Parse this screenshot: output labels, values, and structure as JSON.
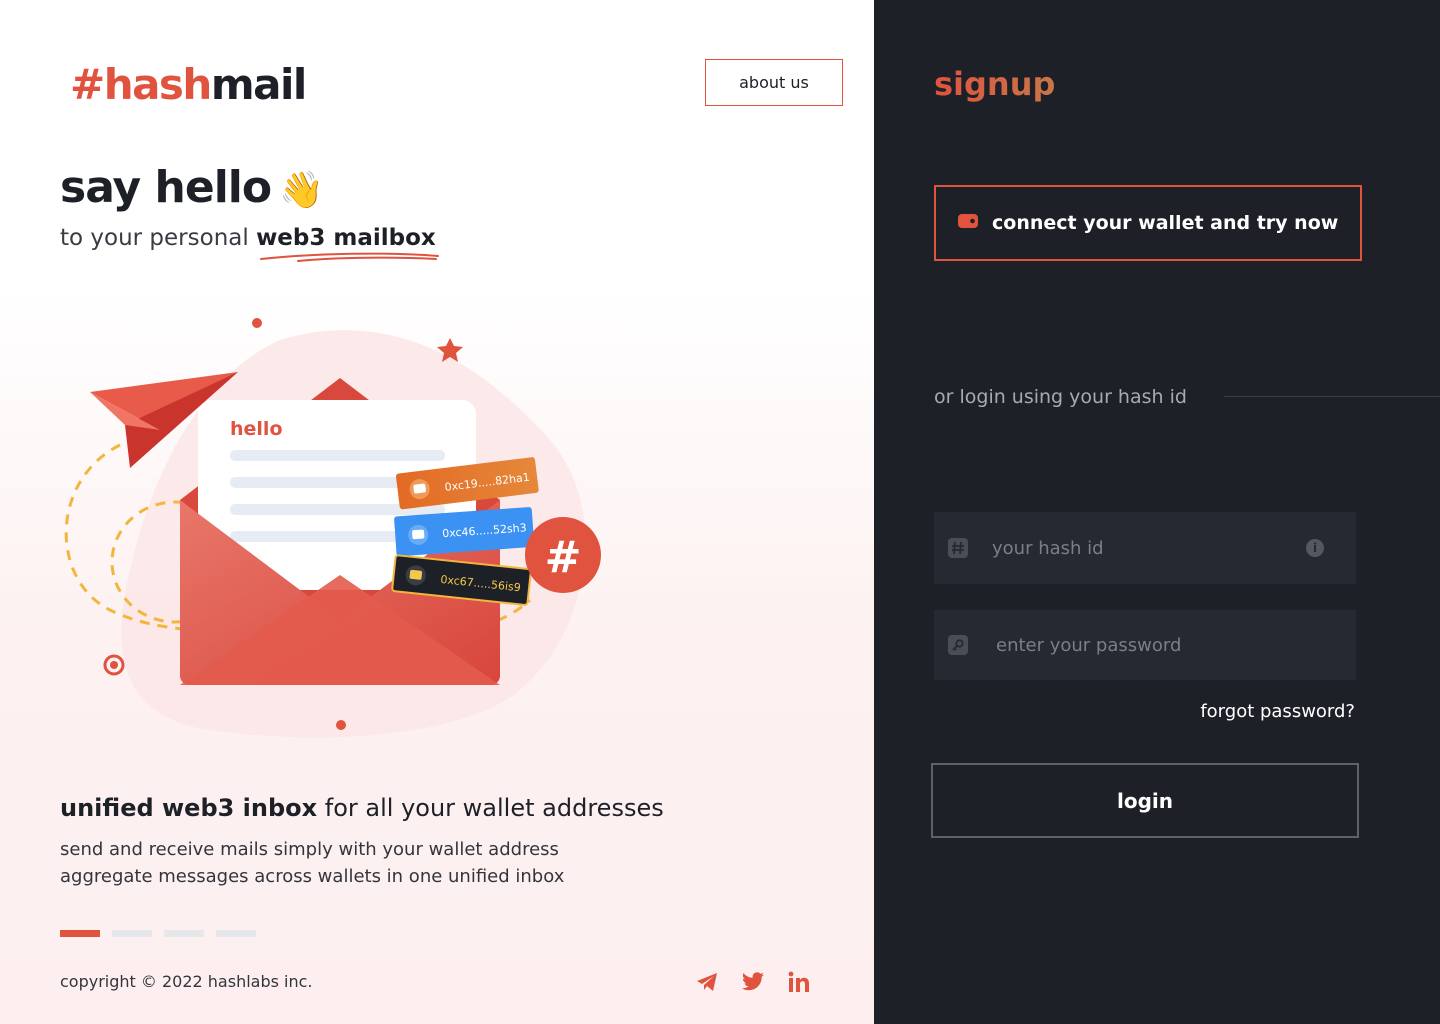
{
  "brand": {
    "logo_accent": "#hash",
    "logo_rest": "mail",
    "accent_color": "#e0533f",
    "dark_bg": "#1e2028"
  },
  "header": {
    "about_label": "about us"
  },
  "hero": {
    "title": "say hello",
    "wave_icon": "👋",
    "subtitle_prefix": "to your personal ",
    "subtitle_highlight": "web3 mailbox"
  },
  "illustration": {
    "mail_greeting": "hello",
    "wallets": [
      {
        "label": "0xc19.....82ha1",
        "color": "#e37a27"
      },
      {
        "label": "0xc46.....52sh3",
        "color": "#3b92f3"
      },
      {
        "label": "0xc67.....56is9",
        "color": "#1e2028"
      }
    ],
    "hash_badge": "#"
  },
  "feature": {
    "title_bold": "unified web3 inbox",
    "title_rest": " for all your wallet addresses",
    "line1": "send and receive mails simply with your wallet address",
    "line2": "aggregate messages across wallets in one unified inbox"
  },
  "carousel": {
    "active_index": 0,
    "count": 4
  },
  "footer": {
    "copyright": "copyright © 2022 hashlabs inc.",
    "social": [
      "telegram-icon",
      "twitter-icon",
      "linkedin-icon"
    ]
  },
  "signup": {
    "title": "signup",
    "connect_label": "connect your wallet and try now",
    "or_login": "or login using your hash id",
    "hash_placeholder": "your hash id",
    "password_placeholder": "enter your password",
    "forgot_label": "forgot password?",
    "login_label": "login"
  }
}
